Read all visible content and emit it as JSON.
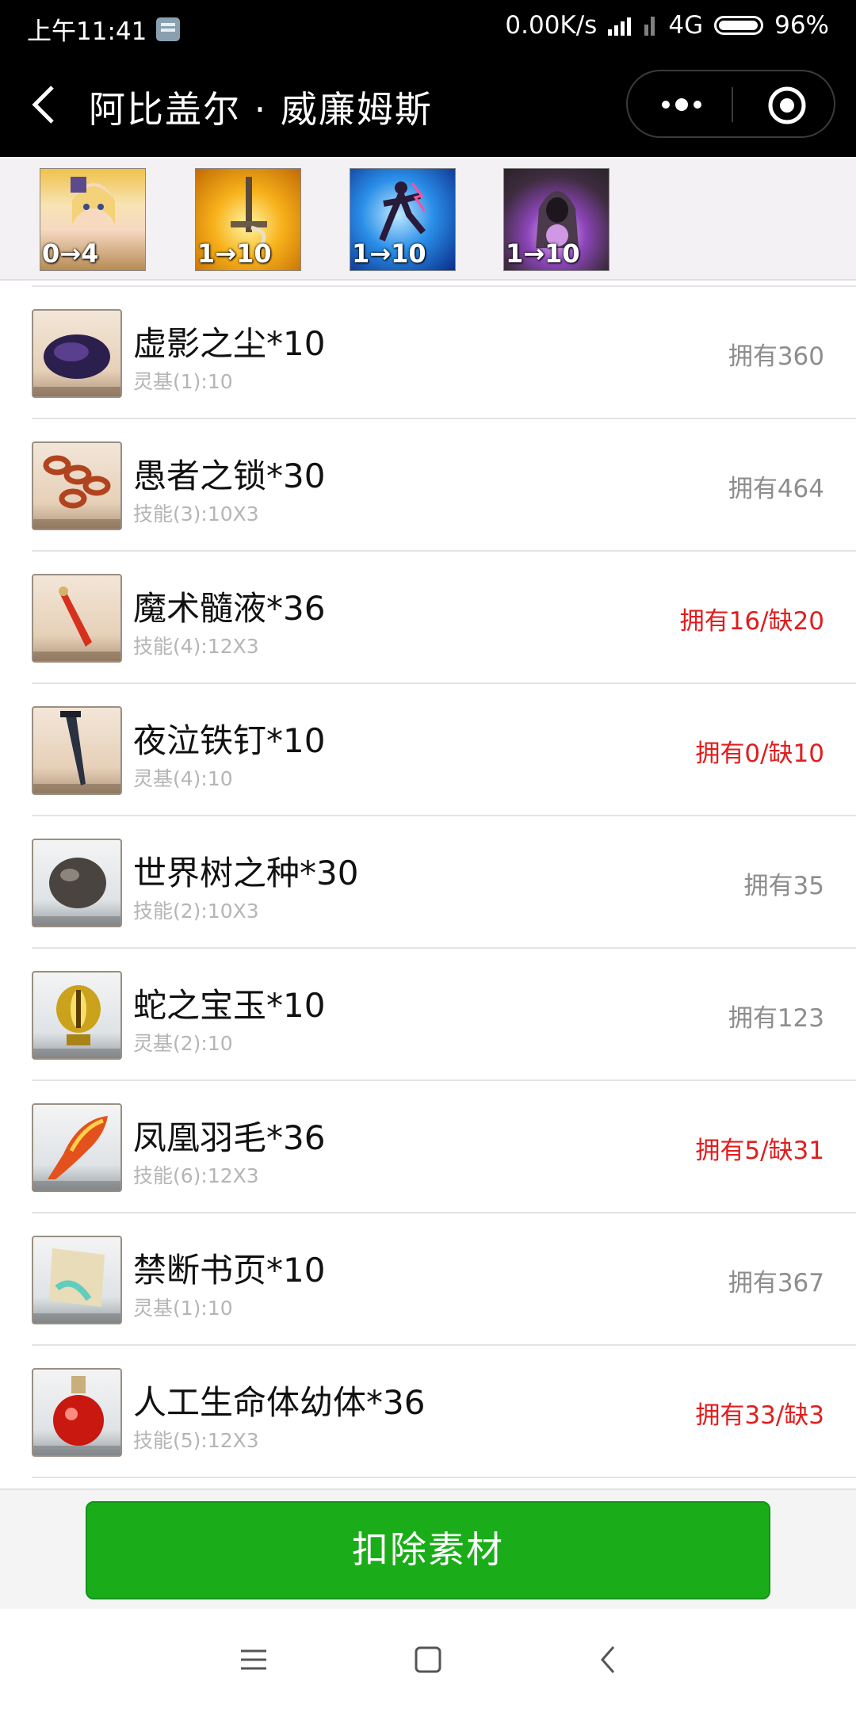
{
  "status_bar": {
    "time": "上午11:41",
    "net_speed": "0.00K/s",
    "network": "4G",
    "battery": "96%"
  },
  "nav": {
    "title": "阿比盖尔 · 威廉姆斯"
  },
  "icon_strip": [
    {
      "icon": "servant-portrait-icon",
      "level": "0→4"
    },
    {
      "icon": "skill-sword-icon",
      "level": "1→10"
    },
    {
      "icon": "skill-lightning-icon",
      "level": "1→10"
    },
    {
      "icon": "skill-hooded-figure-icon",
      "level": "1→10"
    }
  ],
  "materials": [
    {
      "name": "虚影之尘*10",
      "detail": "灵基(1):10",
      "owned": "拥有360",
      "short": false,
      "icon": "dust-icon",
      "frame": "wood"
    },
    {
      "name": "愚者之锁*30",
      "detail": "技能(3):10X3",
      "owned": "拥有464",
      "short": false,
      "icon": "chain-icon",
      "frame": "wood"
    },
    {
      "name": "魔术髓液*36",
      "detail": "技能(4):12X3",
      "owned": "拥有16/缺20",
      "short": true,
      "icon": "vial-icon",
      "frame": "wood"
    },
    {
      "name": "夜泣铁钉*10",
      "detail": "灵基(4):10",
      "owned": "拥有0/缺10",
      "short": true,
      "icon": "nail-icon",
      "frame": "wood"
    },
    {
      "name": "世界树之种*30",
      "detail": "技能(2):10X3",
      "owned": "拥有35",
      "short": false,
      "icon": "seed-icon",
      "frame": "silver"
    },
    {
      "name": "蛇之宝玉*10",
      "detail": "灵基(2):10",
      "owned": "拥有123",
      "short": false,
      "icon": "serpent-jewel-icon",
      "frame": "silver"
    },
    {
      "name": "凤凰羽毛*36",
      "detail": "技能(6):12X3",
      "owned": "拥有5/缺31",
      "short": true,
      "icon": "phoenix-feather-icon",
      "frame": "silver"
    },
    {
      "name": "禁断书页*10",
      "detail": "灵基(1):10",
      "owned": "拥有367",
      "short": false,
      "icon": "forbidden-page-icon",
      "frame": "silver"
    },
    {
      "name": "人工生命体幼体*36",
      "detail": "技能(5):12X3",
      "owned": "拥有33/缺3",
      "short": true,
      "icon": "homunculus-flask-icon",
      "frame": "silver"
    }
  ],
  "actions": {
    "deduct_label": "扣除素材"
  },
  "colors": {
    "accent_green": "#1aad19",
    "short_red": "#e01e1e",
    "owned_gray": "#8d8d8d"
  }
}
